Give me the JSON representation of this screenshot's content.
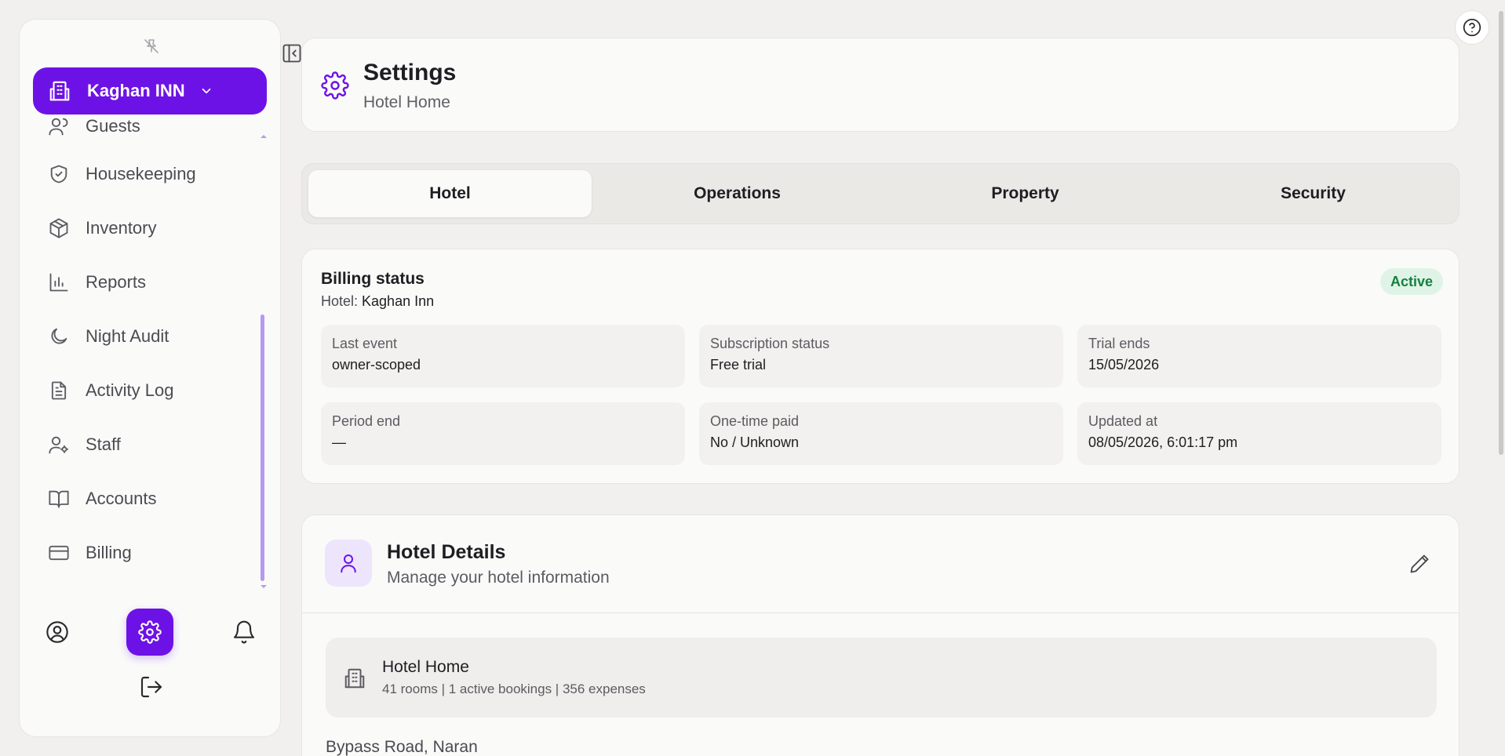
{
  "sidebar": {
    "hotel_switcher": {
      "name": "Kaghan INN"
    },
    "items": [
      {
        "label": "Guests",
        "icon": "users-icon"
      },
      {
        "label": "Housekeeping",
        "icon": "shield-check-icon"
      },
      {
        "label": "Inventory",
        "icon": "box-icon"
      },
      {
        "label": "Reports",
        "icon": "bar-chart-icon"
      },
      {
        "label": "Night Audit",
        "icon": "moon-icon"
      },
      {
        "label": "Activity Log",
        "icon": "file-text-icon"
      },
      {
        "label": "Staff",
        "icon": "user-cog-icon"
      },
      {
        "label": "Accounts",
        "icon": "book-open-icon"
      },
      {
        "label": "Billing",
        "icon": "credit-card-icon"
      }
    ],
    "bottom": [
      "user-circle-icon",
      "gear-icon",
      "bell-icon",
      "logout-icon"
    ]
  },
  "header": {
    "title": "Settings",
    "subtitle": "Hotel Home"
  },
  "tabs": [
    {
      "label": "Hotel",
      "active": true
    },
    {
      "label": "Operations",
      "active": false
    },
    {
      "label": "Property",
      "active": false
    },
    {
      "label": "Security",
      "active": false
    }
  ],
  "billing": {
    "title": "Billing status",
    "hotel_prefix": "Hotel: ",
    "hotel_name": "Kaghan Inn",
    "status_badge": "Active",
    "stats": [
      {
        "label": "Last event",
        "value": "owner-scoped"
      },
      {
        "label": "Subscription status",
        "value": "Free trial"
      },
      {
        "label": "Trial ends",
        "value": "15/05/2026"
      },
      {
        "label": "Period end",
        "value": "—"
      },
      {
        "label": "One-time paid",
        "value": "No / Unknown"
      },
      {
        "label": "Updated at",
        "value": "08/05/2026, 6:01:17 pm"
      }
    ]
  },
  "details": {
    "title": "Hotel Details",
    "subtitle": "Manage your hotel information",
    "hotel": {
      "name": "Hotel Home",
      "meta": "41 rooms | 1 active bookings | 356 expenses"
    },
    "address": "Bypass Road, Naran"
  },
  "colors": {
    "accent": "#6d12e6",
    "active_badge_bg": "#dff4e7",
    "active_badge_text": "#15803d"
  }
}
